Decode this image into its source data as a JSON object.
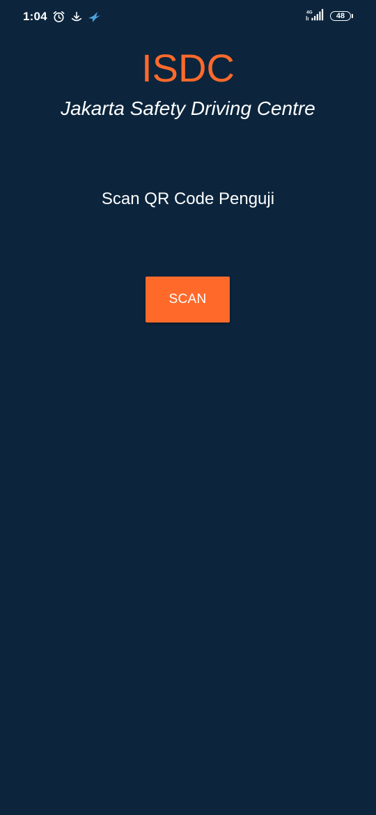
{
  "status_bar": {
    "time": "1:04",
    "network_label": "4G",
    "battery_level": "48",
    "icons": [
      "alarm-icon",
      "download-icon",
      "bird-icon",
      "signal-icon",
      "battery-icon"
    ]
  },
  "header": {
    "title": "ISDC",
    "subtitle": "Jakarta Safety Driving Centre"
  },
  "main": {
    "instruction": "Scan QR Code Penguji",
    "scan_button_label": "SCAN"
  },
  "colors": {
    "background": "#0c253d",
    "accent": "#ff6a2b",
    "text": "#ffffff"
  }
}
